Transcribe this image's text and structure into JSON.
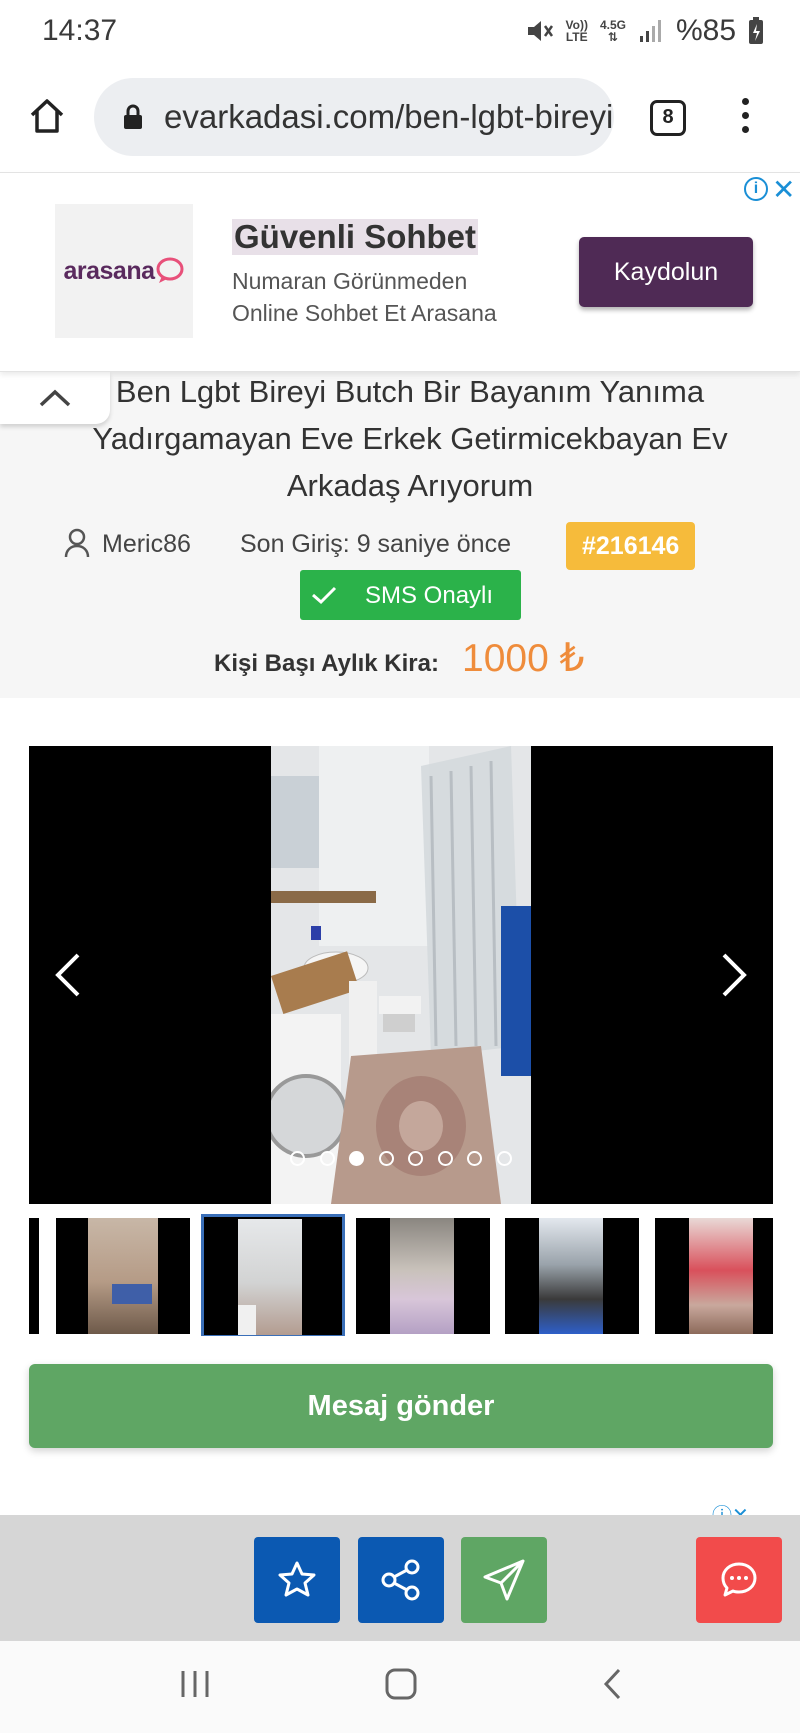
{
  "status_bar": {
    "time": "14:37",
    "volte_top": "Vo))",
    "volte_bottom": "LTE",
    "network": "4.5G",
    "battery": "%85",
    "icons": [
      "mute-icon",
      "signal-icon",
      "battery-icon"
    ]
  },
  "browser": {
    "url": "evarkadasi.com/ben-lgbt-bireyi-butch-bir-bayanim",
    "tab_count": "8",
    "icons": [
      "home-icon",
      "lock-icon",
      "tabs-icon",
      "menu-icon"
    ]
  },
  "ad": {
    "logo": "arasana",
    "title": "Güvenli Sohbet",
    "line1": "Numaran Görünmeden",
    "line2": "Online Sohbet Et Arasana",
    "cta": "Kaydolun",
    "info": "i",
    "close": "✕",
    "accent": "#4f2a55"
  },
  "listing": {
    "title": "Ben Lgbt Bireyi Butch Bir Bayanım Yanıma Yadırgamayan Eve Erkek Getirmicekbayan Ev Arkadaş Arıyorum",
    "username": "Meric86",
    "last_login": "Son Giriş: 9 saniye önce",
    "id": "#216146",
    "sms_badge": "SMS Onaylı",
    "rent_label": "Kişi Başı Aylık Kira:",
    "rent_value": "1000 ₺",
    "colors": {
      "id_badge": "#f6bb3b",
      "sms": "#2bb24a",
      "rent": "#ef8c3b"
    }
  },
  "gallery": {
    "photo_count": 8,
    "active_index": 2,
    "thumbs": [
      "thumb-bedroom",
      "thumb-bathroom",
      "thumb-hallway",
      "thumb-balcony",
      "thumb-room-red"
    ],
    "active_thumb": 1
  },
  "actions": {
    "send_message": "Mesaj gönder",
    "buttons": [
      "star-icon",
      "share-icon",
      "send-icon",
      "chat-icon"
    ]
  }
}
